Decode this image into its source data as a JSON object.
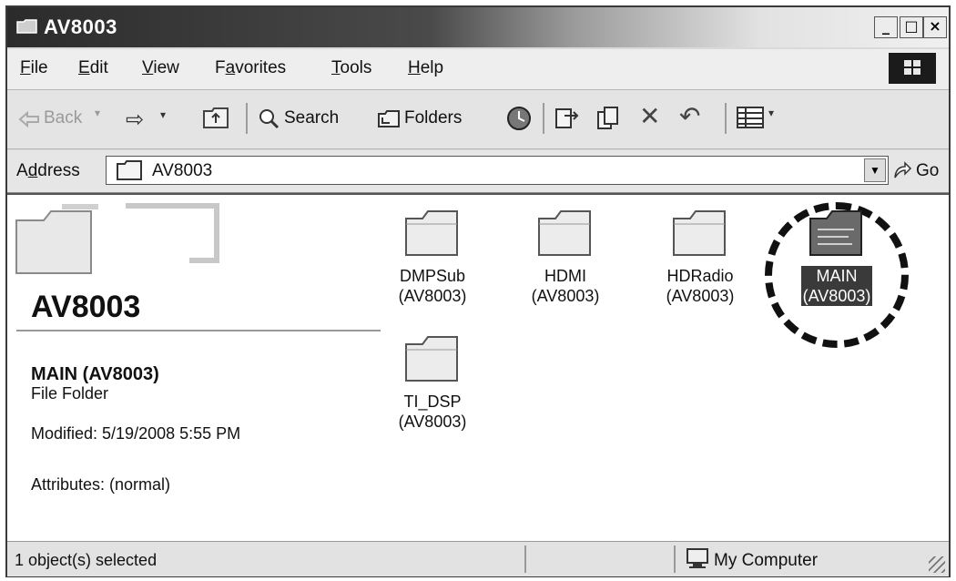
{
  "window": {
    "title": "AV8003",
    "controls": {
      "minimize": "_",
      "maximize": "□",
      "close": "×"
    }
  },
  "menu": [
    {
      "label": "File",
      "accel": "F",
      "rest": "ile"
    },
    {
      "label": "Edit",
      "accel": "E",
      "rest": "dit"
    },
    {
      "label": "View",
      "accel": "V",
      "rest": "iew"
    },
    {
      "label": "Favorites",
      "pre": "F",
      "accel": "a",
      "rest": "vorites"
    },
    {
      "label": "Tools",
      "accel": "T",
      "rest": "ools"
    },
    {
      "label": "Help",
      "accel": "H",
      "rest": "elp"
    }
  ],
  "toolbar": {
    "back": "Back",
    "forward_arrow": "⇨",
    "search": "Search",
    "folders": "Folders",
    "delete_icon": "✕",
    "undo_icon": "↶"
  },
  "address": {
    "label_pre": "A",
    "label_accel": "d",
    "label_rest": "dress",
    "value": "AV8003",
    "go": "Go"
  },
  "left_panel": {
    "folder_title": "AV8003",
    "selected_name": "MAIN (AV8003)",
    "selected_type": "File Folder",
    "modified": "Modified: 5/19/2008 5:55 PM",
    "attributes": "Attributes: (normal)"
  },
  "folders": [
    {
      "line1": "DMPSub",
      "line2": "(AV8003)",
      "selected": false
    },
    {
      "line1": "HDMI",
      "line2": "(AV8003)",
      "selected": false
    },
    {
      "line1": "HDRadio",
      "line2": "(AV8003)",
      "selected": false
    },
    {
      "line1": "MAIN",
      "line2": "(AV8003)",
      "selected": true
    },
    {
      "line1": "TI_DSP",
      "line2": "(AV8003)",
      "selected": false
    }
  ],
  "status": {
    "left": "1 object(s) selected",
    "right": "My Computer"
  },
  "colors": {
    "title_gradient_start": "#2b2b2b",
    "selection": "#3a3a3a",
    "window_face": "#d9d9d9"
  }
}
